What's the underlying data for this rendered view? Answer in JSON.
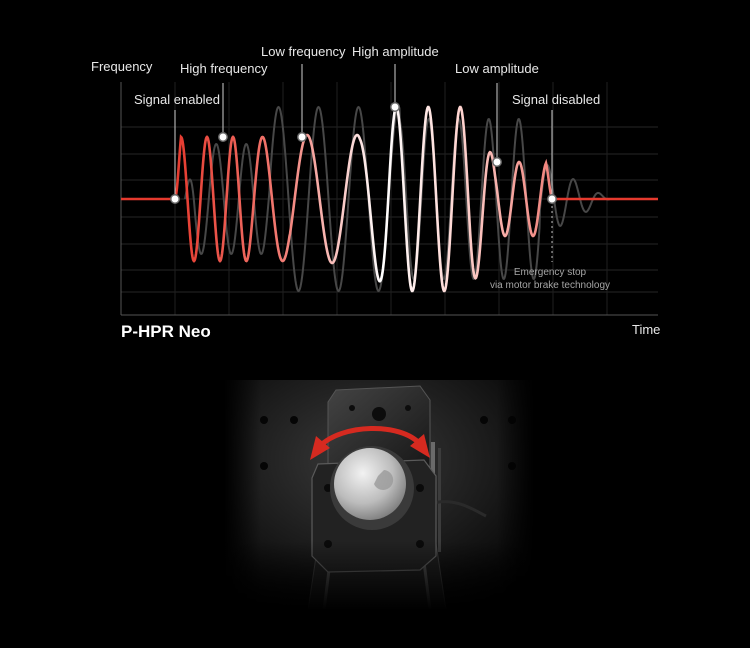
{
  "axes": {
    "y_label": "Frequency",
    "x_label": "Time"
  },
  "product_name": "P-HPR Neo",
  "annotations": {
    "signal_enabled": "Signal enabled",
    "high_frequency": "High frequency",
    "low_frequency": "Low frequency",
    "high_amplitude": "High amplitude",
    "low_amplitude": "Low amplitude",
    "signal_disabled": "Signal disabled"
  },
  "emergency_note": {
    "line1": "Emergency stop",
    "line2": "via motor brake technology"
  },
  "colors": {
    "signal_red": "#e63a2e",
    "signal_pink": "#f0817a",
    "signal_white": "#ffffff",
    "ghost_wave": "#4a4a4a",
    "grid": "#2a2a2a",
    "rotation_arrow": "#d62a20"
  }
}
